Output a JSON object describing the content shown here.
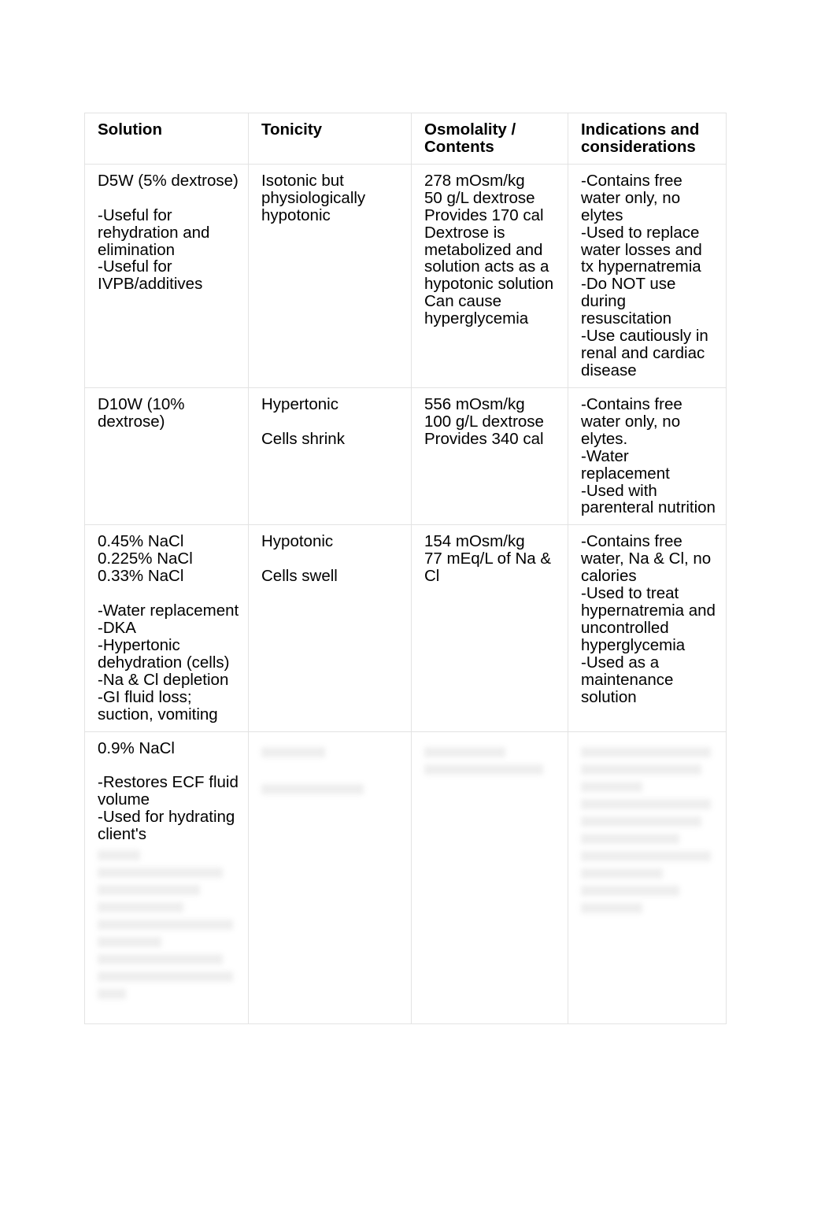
{
  "document": {
    "title": "IV Solutions Reference Table",
    "background_color": "#ffffff",
    "text_color": "#000000",
    "border_color": "#e3e3e3"
  },
  "table": {
    "headers": [
      "Solution",
      "Tonicity",
      "Osmolality / Contents",
      "Indications and considerations"
    ],
    "rows": [
      {
        "solution": "D5W (5% dextrose)\n\n-Useful for rehydration and elimination\n-Useful for IVPB/additives",
        "tonicity": "Isotonic but physiologically hypotonic",
        "osmolality": "278 mOsm/kg\n50 g/L dextrose\nProvides 170 cal\nDextrose is metabolized and solution acts as a hypotonic solution\nCan cause hyperglycemia",
        "indications": "-Contains free water only, no elytes\n-Used to replace water losses and tx hypernatremia\n-Do NOT use during resuscitation\n-Use cautiously in renal and cardiac disease"
      },
      {
        "solution": "D10W (10% dextrose)",
        "tonicity": "Hypertonic\n\nCells shrink",
        "osmolality": "556 mOsm/kg\n100 g/L dextrose\nProvides 340 cal",
        "indications": "-Contains free water only, no elytes.\n-Water replacement\n-Used with parenteral nutrition"
      },
      {
        "solution": "0.45% NaCl\n0.225% NaCl\n0.33% NaCl\n\n-Water replacement\n-DKA\n-Hypertonic dehydration (cells)\n-Na & Cl depletion\n-GI fluid loss; suction, vomiting",
        "tonicity": "Hypotonic\n\nCells swell",
        "osmolality": "154 mOsm/kg\n77 mEq/L of Na & Cl",
        "indications": "-Contains free water, Na & Cl, no calories\n-Used to treat hypernatremia and uncontrolled hyperglycemia\n-Used as a maintenance solution"
      },
      {
        "solution": "0.9% NaCl\n\n-Restores ECF fluid volume\n-Used for hydrating client's",
        "tonicity": "",
        "osmolality": "",
        "indications": ""
      }
    ]
  }
}
